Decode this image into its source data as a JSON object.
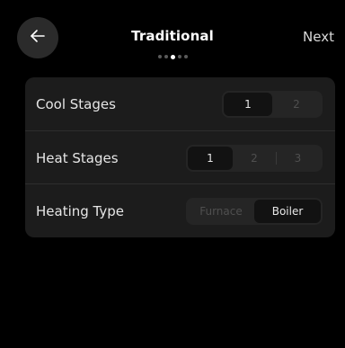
{
  "header": {
    "title": "Traditional",
    "next_label": "Next",
    "back_icon": "arrow-left-icon"
  },
  "pagination": {
    "total": 5,
    "active_index": 2
  },
  "settings": {
    "cool_stages": {
      "label": "Cool Stages",
      "options": [
        "1",
        "2"
      ],
      "selected": "1"
    },
    "heat_stages": {
      "label": "Heat Stages",
      "options": [
        "1",
        "2",
        "3"
      ],
      "selected": "1"
    },
    "heating_type": {
      "label": "Heating Type",
      "options": [
        "Furnace",
        "Boiler"
      ],
      "selected": "Boiler"
    }
  },
  "colors": {
    "background": "#000000",
    "card": "#1c1c1c",
    "selected_option": "#121212",
    "text": "#ffffff"
  }
}
